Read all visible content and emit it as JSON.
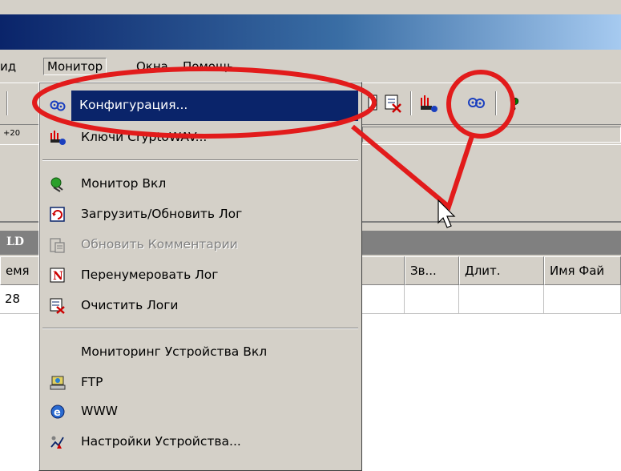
{
  "menubar": {
    "partial_left": "ид",
    "items": [
      {
        "label": "Монитор"
      },
      {
        "label": "Окна"
      },
      {
        "label": "Помощь"
      }
    ]
  },
  "toolbar2": {
    "zoom": "+20"
  },
  "grid": {
    "caption": "LD",
    "columns": [
      "емя",
      "",
      "Зв...",
      "Длит.",
      "Имя Фай"
    ],
    "rows": [
      [
        "28",
        "",
        "",
        "",
        ""
      ]
    ]
  },
  "dropdown": {
    "items": [
      {
        "label": "Конфигурация...",
        "icon": "config-icon",
        "state": "highlighted"
      },
      {
        "label": "Ключи CryptoWAV...",
        "icon": "keys-icon",
        "state": "normal"
      },
      {
        "separator": true
      },
      {
        "label": "Монитор Вкл",
        "icon": "monitor-on-icon",
        "state": "normal"
      },
      {
        "label": "Загрузить/Обновить Лог",
        "icon": "refresh-log-icon",
        "state": "normal"
      },
      {
        "label": "Обновить Комментарии",
        "icon": "update-comments-icon",
        "state": "disabled"
      },
      {
        "label": "Перенумеровать Лог",
        "icon": "renumber-icon",
        "state": "normal"
      },
      {
        "label": "Очистить Логи",
        "icon": "clear-logs-icon",
        "state": "normal"
      },
      {
        "separator": true
      },
      {
        "label": "Мониторинг Устройства Вкл",
        "icon": "",
        "state": "normal"
      },
      {
        "label": "FTP",
        "icon": "ftp-icon",
        "state": "normal"
      },
      {
        "label": "WWW",
        "icon": "www-icon",
        "state": "normal"
      },
      {
        "label": "Настройки Устройства...",
        "icon": "device-settings-icon",
        "state": "normal"
      }
    ]
  },
  "colors": {
    "highlight": "#0a246a",
    "annotation": "#e21b1b",
    "face": "#d4d0c8"
  }
}
